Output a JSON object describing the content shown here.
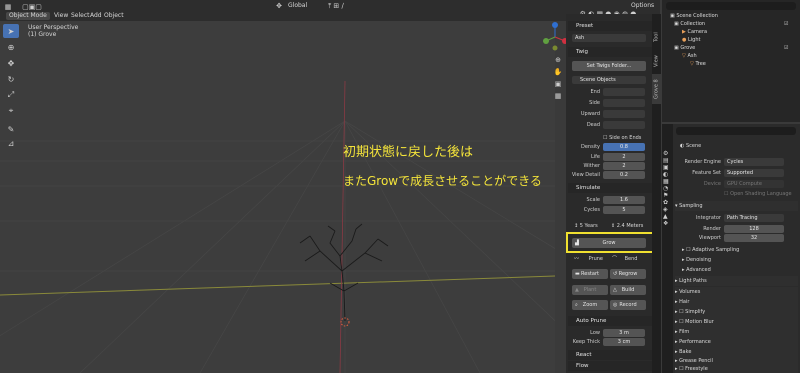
{
  "header": {
    "mode": "Object Mode",
    "menus": [
      "View",
      "Select",
      "Add",
      "Object"
    ],
    "transform_orientation": "Global",
    "options": "Options"
  },
  "viewport": {
    "perspective": "User Perspective",
    "collection": "(1) Grove"
  },
  "annotation": {
    "line1": "初期状態に戻した後は",
    "line2": "またGrowで成長させることができる",
    "color": "#f5e53a",
    "highlight_color": "#f0e030"
  },
  "npanel": {
    "preset": {
      "title": "Preset",
      "value": "Ash"
    },
    "twig": {
      "title": "Twig",
      "set_twigs_button": "Set Twigs Folder...",
      "scene_objects": "Scene Objects",
      "rows": [
        "End",
        "Side",
        "Upward",
        "Dead"
      ],
      "side_on_ends": "Side on Ends"
    },
    "density": {
      "label": "Density",
      "value": "0.8"
    },
    "life": {
      "label": "Life",
      "value": "2"
    },
    "wither": {
      "label": "Wither",
      "value": "2"
    },
    "view_detail": {
      "label": "View Detail",
      "value": "0.2"
    },
    "simulate": {
      "title": "Simulate",
      "scale_label": "Scale",
      "scale_value": "1.6",
      "cycles_label": "Cycles",
      "cycles_value": "5",
      "years": "5 Years",
      "meters": "2.4 Meters",
      "grow": "Grow",
      "prune": "Prune",
      "bend": "Bend",
      "restart": "Restart",
      "regrow": "Regrow",
      "plant": "Plant",
      "build": "Build",
      "zoom": "Zoom",
      "record": "Record"
    },
    "auto_prune": {
      "title": "Auto Prune",
      "low_label": "Low",
      "low_value": "3 m",
      "keep_thick_label": "Keep Thick",
      "keep_thick_value": "3 cm"
    },
    "react": "React",
    "flow": "Flow"
  },
  "vtabs": [
    "Tool",
    "View",
    "Grove 8"
  ],
  "outliner": {
    "scene_collection": "Scene Collection",
    "items": [
      {
        "name": "Collection",
        "level": 1
      },
      {
        "name": "Camera",
        "level": 2
      },
      {
        "name": "Light",
        "level": 2
      },
      {
        "name": "Grove",
        "level": 1
      },
      {
        "name": "Ash",
        "level": 2
      },
      {
        "name": "Tree",
        "level": 3
      }
    ]
  },
  "properties": {
    "scene": "Scene",
    "sections": {
      "render_engine_label": "Render Engine",
      "render_engine": "Cycles",
      "feature_set_label": "Feature Set",
      "feature_set": "Supported",
      "device_label": "Device",
      "device": "GPU Compute",
      "osl": "Open Shading Language",
      "sampling": "Sampling",
      "integrator_label": "Integrator",
      "integrator": "Path Tracing",
      "render_label": "Render",
      "render_value": "128",
      "viewport_label": "Viewport",
      "viewport_value": "32",
      "adaptive": "Adaptive Sampling",
      "denoising": "Denoising",
      "advanced": "Advanced",
      "light_paths": "Light Paths",
      "volumes": "Volumes",
      "hair": "Hair",
      "simplify": "Simplify",
      "motion_blur": "Motion Blur",
      "film": "Film",
      "performance": "Performance",
      "bake": "Bake",
      "grease_pencil": "Grease Pencil",
      "freestyle": "Freestyle"
    }
  }
}
